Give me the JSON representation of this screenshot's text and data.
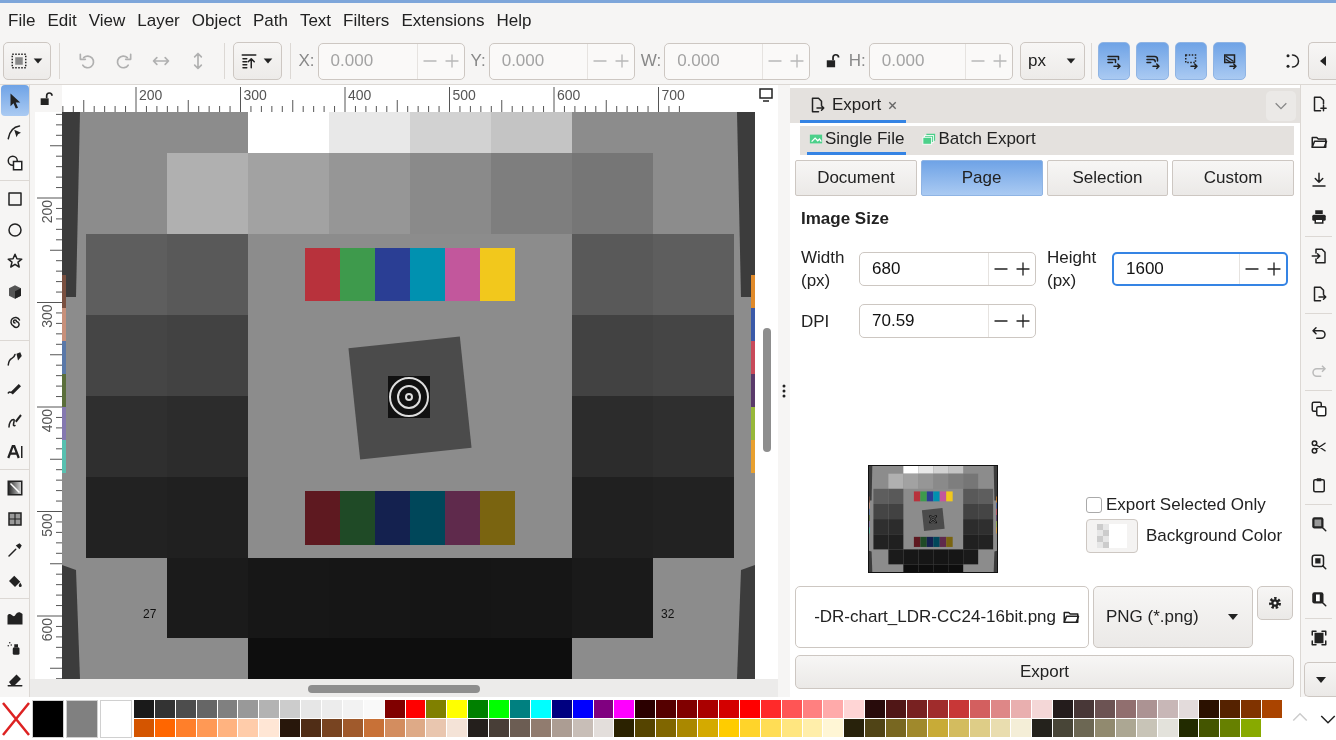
{
  "menu": [
    "File",
    "Edit",
    "View",
    "Layer",
    "Object",
    "Path",
    "Text",
    "Filters",
    "Extensions",
    "Help"
  ],
  "toolbar": {
    "actions": [
      {
        "disabled": true
      },
      {
        "disabled": true
      },
      {
        "disabled": true
      },
      {
        "disabled": true
      }
    ],
    "fields": [
      {
        "label": "X:",
        "value": "0.000",
        "disabled": true
      },
      {
        "label": "Y:",
        "value": "0.000",
        "disabled": true
      },
      {
        "label": "W:",
        "value": "0.000",
        "disabled": true
      },
      {
        "label": "H:",
        "value": "0.000",
        "disabled": true
      }
    ],
    "unit": "px",
    "toggles": [
      {
        "on": true
      },
      {
        "on": true
      },
      {
        "on": true
      },
      {
        "on": true
      }
    ]
  },
  "tools": [
    {
      "selected": true
    },
    {
      "selected": false
    },
    {
      "selected": false
    },
    {
      "selected": false
    },
    {
      "selected": false
    },
    {
      "selected": false
    },
    {
      "selected": false
    },
    {
      "selected": false
    },
    {
      "selected": false
    },
    {
      "selected": false
    },
    {
      "selected": false
    },
    {
      "selected": false
    },
    {
      "selected": false
    },
    {
      "selected": false
    },
    {
      "selected": false
    },
    {
      "selected": false
    },
    {
      "selected": false
    },
    {
      "selected": false
    },
    {
      "selected": false
    }
  ],
  "rulers": {
    "horizontal": [
      "200",
      "300",
      "400",
      "500",
      "600",
      "700"
    ],
    "vertical": [
      "200",
      "300",
      "400",
      "500",
      "600"
    ]
  },
  "canvas": {
    "labels": [
      "27",
      "32"
    ]
  },
  "export_panel": {
    "tab": "Export",
    "modes": [
      {
        "label": "Single File",
        "selected": true
      },
      {
        "label": "Batch Export",
        "selected": false
      }
    ],
    "areas": [
      {
        "label": "Document",
        "selected": false
      },
      {
        "label": "Page",
        "selected": true
      },
      {
        "label": "Selection",
        "selected": false
      },
      {
        "label": "Custom",
        "selected": false
      }
    ],
    "section_title": "Image Size",
    "fields": [
      {
        "label": "Width (px)",
        "value": "680",
        "focused": false
      },
      {
        "label": "Height (px)",
        "value": "1600",
        "focused": true
      },
      {
        "label": "DPI",
        "value": "70.59",
        "focused": false
      }
    ],
    "export_selected_only": {
      "label": "Export Selected Only",
      "checked": false
    },
    "background_color": {
      "label": "Background Color"
    },
    "filename": "-DR-chart_LDR-CC24-16bit.png",
    "file_type": "PNG (*.png)",
    "export_button": "Export"
  },
  "palette": {
    "main": [
      {
        "color": "#000000"
      },
      {
        "color": "#808080"
      },
      {
        "color": "#ffffff"
      }
    ],
    "top_row": [
      {
        "color": "#1a1a1a"
      },
      {
        "color": "#333333"
      },
      {
        "color": "#4d4d4d"
      },
      {
        "color": "#666666"
      },
      {
        "color": "#808080"
      },
      {
        "color": "#999999"
      },
      {
        "color": "#b3b3b3"
      },
      {
        "color": "#cccccc"
      },
      {
        "color": "#e6e6e6"
      },
      {
        "color": "#ececec"
      },
      {
        "color": "#f2f2f2"
      },
      {
        "color": "#f9f9f9"
      },
      {
        "color": "#800000"
      },
      {
        "color": "#ff0000"
      },
      {
        "color": "#808000"
      },
      {
        "color": "#ffff00"
      },
      {
        "color": "#008000"
      },
      {
        "color": "#00ff00"
      },
      {
        "color": "#008080"
      },
      {
        "color": "#00ffff"
      },
      {
        "color": "#000080"
      },
      {
        "color": "#0000ff"
      },
      {
        "color": "#800080"
      },
      {
        "color": "#ff00ff"
      },
      {
        "color": "#2b0000"
      },
      {
        "color": "#550000"
      },
      {
        "color": "#800000"
      },
      {
        "color": "#aa0000"
      },
      {
        "color": "#d40000"
      },
      {
        "color": "#ff0000"
      },
      {
        "color": "#ff2a2a"
      },
      {
        "color": "#ff5555"
      },
      {
        "color": "#ff8080"
      },
      {
        "color": "#ffaaaa"
      },
      {
        "color": "#ffd5d5"
      },
      {
        "color": "#280b0b"
      },
      {
        "color": "#501616"
      },
      {
        "color": "#782121"
      },
      {
        "color": "#a02c2c"
      },
      {
        "color": "#c83737"
      },
      {
        "color": "#d35f5f"
      },
      {
        "color": "#de8787"
      },
      {
        "color": "#e9afaf"
      },
      {
        "color": "#f4d7d7"
      },
      {
        "color": "#241c1c"
      },
      {
        "color": "#483737"
      },
      {
        "color": "#6c5353"
      },
      {
        "color": "#916f6f"
      },
      {
        "color": "#ac9393"
      },
      {
        "color": "#c8b7b7"
      },
      {
        "color": "#e3dbdb"
      },
      {
        "color": "#2b1100"
      },
      {
        "color": "#552200"
      },
      {
        "color": "#803300"
      },
      {
        "color": "#aa4400"
      }
    ],
    "bottom_row": [
      {
        "color": "#d45500"
      },
      {
        "color": "#ff6600"
      },
      {
        "color": "#ff7f2a"
      },
      {
        "color": "#ff9955"
      },
      {
        "color": "#ffb380"
      },
      {
        "color": "#ffccaa"
      },
      {
        "color": "#ffe6d5"
      },
      {
        "color": "#28170b"
      },
      {
        "color": "#502d16"
      },
      {
        "color": "#784421"
      },
      {
        "color": "#a05a2c"
      },
      {
        "color": "#c87137"
      },
      {
        "color": "#d38d5f"
      },
      {
        "color": "#deaa87"
      },
      {
        "color": "#e9c6af"
      },
      {
        "color": "#f4e3d7"
      },
      {
        "color": "#241f1c"
      },
      {
        "color": "#483e37"
      },
      {
        "color": "#6c5d53"
      },
      {
        "color": "#917c6f"
      },
      {
        "color": "#ac9d93"
      },
      {
        "color": "#c8beb7"
      },
      {
        "color": "#e3dedb"
      },
      {
        "color": "#2b2200"
      },
      {
        "color": "#554400"
      },
      {
        "color": "#806600"
      },
      {
        "color": "#aa8800"
      },
      {
        "color": "#d4aa00"
      },
      {
        "color": "#ffcc00"
      },
      {
        "color": "#ffd42a"
      },
      {
        "color": "#ffdd55"
      },
      {
        "color": "#ffe680"
      },
      {
        "color": "#ffeeaa"
      },
      {
        "color": "#fff6d5"
      },
      {
        "color": "#28220b"
      },
      {
        "color": "#504416"
      },
      {
        "color": "#786721"
      },
      {
        "color": "#a0892c"
      },
      {
        "color": "#c8ab37"
      },
      {
        "color": "#d3bc5f"
      },
      {
        "color": "#decd87"
      },
      {
        "color": "#e9ddaf"
      },
      {
        "color": "#f4eed7"
      },
      {
        "color": "#24221c"
      },
      {
        "color": "#484537"
      },
      {
        "color": "#6c6753"
      },
      {
        "color": "#918a6f"
      },
      {
        "color": "#aca793"
      },
      {
        "color": "#c8c4b7"
      },
      {
        "color": "#e3e2db"
      },
      {
        "color": "#222b00"
      },
      {
        "color": "#445500"
      },
      {
        "color": "#668000"
      },
      {
        "color": "#88aa00"
      }
    ]
  }
}
